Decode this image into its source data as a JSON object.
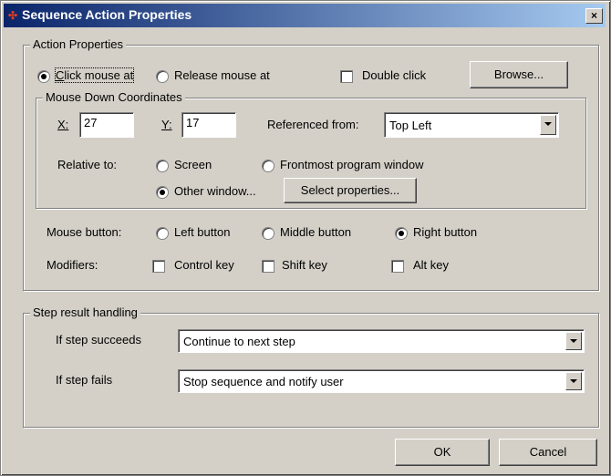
{
  "window": {
    "title": "Sequence Action Properties",
    "close_label": "×"
  },
  "action_properties": {
    "legend": "Action Properties",
    "click_mouse_at": "Click mouse at",
    "release_mouse_at": "Release mouse at",
    "double_click": "Double click",
    "browse": "Browse...",
    "selected_action": "Click mouse at"
  },
  "mouse_down": {
    "legend": "Mouse Down Coordinates",
    "x_label": "X:",
    "x_value": "27",
    "y_label": "Y:",
    "y_value": "17",
    "referenced_from_label": "Referenced from:",
    "referenced_from_value": "Top Left",
    "relative_to_label": "Relative to:",
    "screen": "Screen",
    "frontmost": "Frontmost program window",
    "other_window": "Other window...",
    "select_properties": "Select properties...",
    "selected_relative": "Other window..."
  },
  "mouse_button": {
    "label": "Mouse button:",
    "left": "Left button",
    "middle": "Middle button",
    "right": "Right button",
    "selected": "Right button"
  },
  "modifiers": {
    "label": "Modifiers:",
    "control": "Control key",
    "shift": "Shift key",
    "alt": "Alt key"
  },
  "step_result": {
    "legend": "Step result handling",
    "succeeds_label": "If step succeeds",
    "succeeds_value": "Continue to next step",
    "fails_label": "If step fails",
    "fails_value": "Stop sequence and notify user"
  },
  "buttons": {
    "ok": "OK",
    "cancel": "Cancel"
  }
}
